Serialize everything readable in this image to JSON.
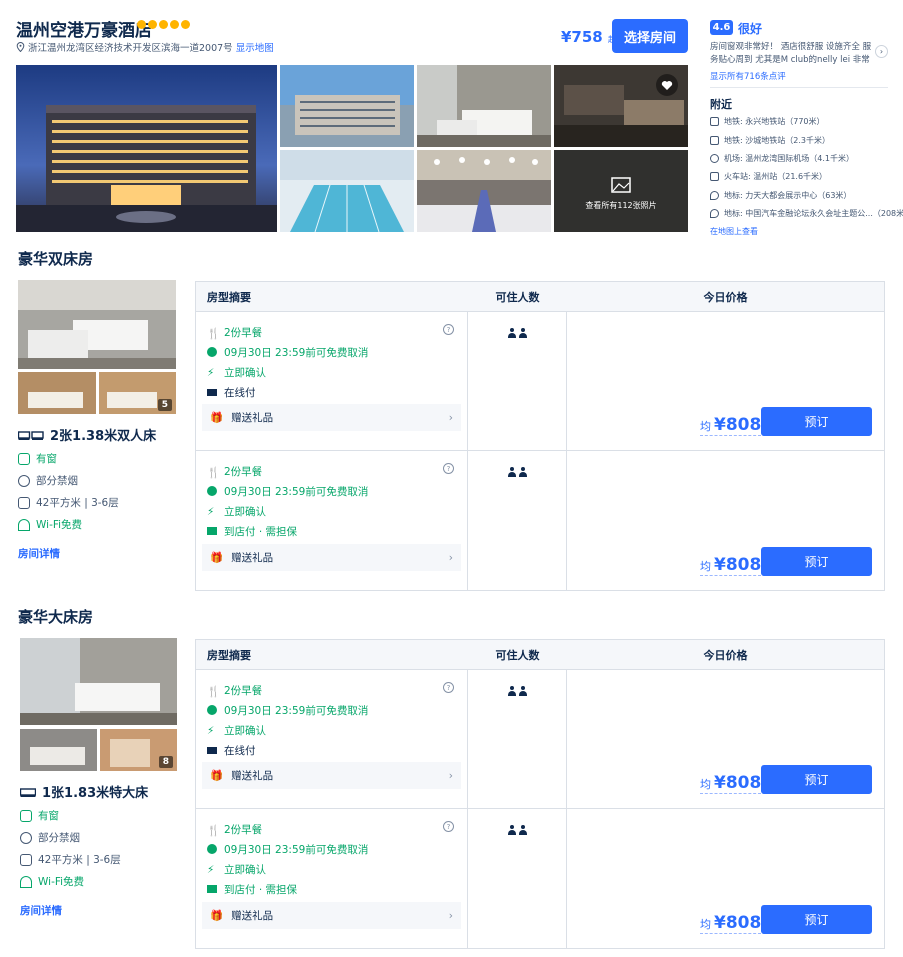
{
  "hotel": {
    "name": "温州空港万豪酒店",
    "address": "浙江温州龙湾区经济技术开发区滨海一道2007号",
    "map_link": "显示地图",
    "price": "¥758",
    "price_suffix": "起",
    "choose_room": "选择房间",
    "photos_label": "查看所有112张照片"
  },
  "review": {
    "score": "4.6",
    "word": "很好",
    "text": "房间窗观非常好！ 酒店很舒服 设施齐全 服务贴心周到 尤其是M club的nelly lei 非常可爱温柔 知道我们...",
    "all_link": "显示所有716条点评"
  },
  "nearby": {
    "title": "附近",
    "items": [
      "地铁: 永兴地铁站（770米）",
      "地铁: 沙城地铁站（2.3千米）",
      "机场: 温州龙湾国际机场（4.1千米）",
      "火车站: 温州站（21.6千米）",
      "地标: 力天大都会展示中心（63米）",
      "地标: 中国汽车金融论坛永久会址主题公...（208米）"
    ],
    "map_view": "在地图上查看"
  },
  "table_headers": {
    "summary": "房型摘要",
    "occupancy": "可住人数",
    "price": "今日价格"
  },
  "rooms": [
    {
      "title": "豪华双床房",
      "photo_count": "5",
      "bed": "2张1.38米双人床",
      "features": [
        "有窗",
        "部分禁烟",
        "42平方米 | 3-6层",
        "Wi-Fi免费"
      ],
      "details": "房间详情",
      "plans": [
        {
          "breakfast": "2份早餐",
          "cancel": "09月30日 23:59前可免费取消",
          "confirm": "立即确认",
          "payment": "在线付",
          "gift": "赠送礼品",
          "avg": "均",
          "price": "¥808",
          "book": "预订"
        },
        {
          "breakfast": "2份早餐",
          "cancel": "09月30日 23:59前可免费取消",
          "confirm": "立即确认",
          "payment": "到店付 · 需担保",
          "gift": "赠送礼品",
          "avg": "均",
          "price": "¥808",
          "book": "预订"
        }
      ]
    },
    {
      "title": "豪华大床房",
      "photo_count": "8",
      "bed": "1张1.83米特大床",
      "features": [
        "有窗",
        "部分禁烟",
        "42平方米 | 3-6层",
        "Wi-Fi免费"
      ],
      "details": "房间详情",
      "plans": [
        {
          "breakfast": "2份早餐",
          "cancel": "09月30日 23:59前可免费取消",
          "confirm": "立即确认",
          "payment": "在线付",
          "gift": "赠送礼品",
          "avg": "均",
          "price": "¥808",
          "book": "预订"
        },
        {
          "breakfast": "2份早餐",
          "cancel": "09月30日 23:59前可免费取消",
          "confirm": "立即确认",
          "payment": "到店付 · 需担保",
          "gift": "赠送礼品",
          "avg": "均",
          "price": "¥808",
          "book": "预订"
        }
      ]
    }
  ],
  "colors": {
    "accent": "#2b6cff",
    "green": "#06a66a",
    "text": "#0f294d",
    "star": "#ffb400"
  }
}
